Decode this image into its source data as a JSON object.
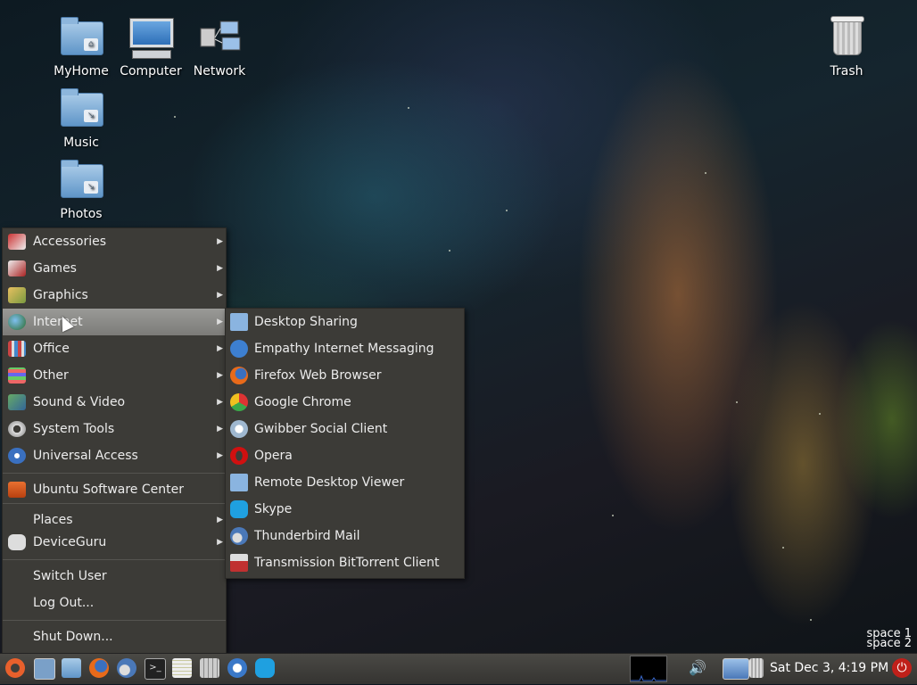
{
  "desktop": {
    "icons": [
      {
        "label": "MyHome",
        "icon": "home-folder-icon"
      },
      {
        "label": "Computer",
        "icon": "computer-icon"
      },
      {
        "label": "Network",
        "icon": "network-icon"
      },
      {
        "label": "Trash",
        "icon": "trash-icon"
      },
      {
        "label": "Music",
        "icon": "music-folder-icon"
      },
      {
        "label": "Photos",
        "icon": "photos-folder-icon"
      }
    ]
  },
  "main_menu": {
    "items": [
      {
        "label": "Accessories",
        "icon": "accessories-icon",
        "submenu": true
      },
      {
        "label": "Games",
        "icon": "games-icon",
        "submenu": true
      },
      {
        "label": "Graphics",
        "icon": "graphics-icon",
        "submenu": true
      },
      {
        "label": "Internet",
        "icon": "internet-icon",
        "submenu": true,
        "active": true
      },
      {
        "label": "Office",
        "icon": "office-icon",
        "submenu": true
      },
      {
        "label": "Other",
        "icon": "other-icon",
        "submenu": true
      },
      {
        "label": "Sound & Video",
        "icon": "sound-video-icon",
        "submenu": true
      },
      {
        "label": "System Tools",
        "icon": "system-tools-icon",
        "submenu": true
      },
      {
        "label": "Universal Access",
        "icon": "universal-access-icon",
        "submenu": true
      },
      {
        "label": "Ubuntu Software Center",
        "icon": "software-center-icon",
        "submenu": false
      },
      {
        "label": "Places",
        "icon": "",
        "submenu": true
      },
      {
        "label": "DeviceGuru",
        "icon": "deviceguru-icon",
        "submenu": true
      },
      {
        "label": "Switch User",
        "icon": "",
        "submenu": false
      },
      {
        "label": "Log Out...",
        "icon": "",
        "submenu": false
      },
      {
        "label": "Shut Down...",
        "icon": "",
        "submenu": false
      }
    ]
  },
  "internet_submenu": {
    "items": [
      {
        "label": "Desktop Sharing",
        "icon": "desktop-sharing-icon",
        "color": "#8ab4e0"
      },
      {
        "label": "Empathy Internet Messaging",
        "icon": "empathy-icon",
        "color": "#3d7fd0"
      },
      {
        "label": "Firefox Web Browser",
        "icon": "firefox-icon",
        "color": "#e86a1a"
      },
      {
        "label": "Google Chrome",
        "icon": "chrome-icon",
        "color": "#3aa84a"
      },
      {
        "label": "Gwibber Social Client",
        "icon": "gwibber-icon",
        "color": "#9fb8d0"
      },
      {
        "label": "Opera",
        "icon": "opera-icon",
        "color": "#d01010"
      },
      {
        "label": "Remote Desktop Viewer",
        "icon": "remote-desktop-icon",
        "color": "#8ab4e0"
      },
      {
        "label": "Skype",
        "icon": "skype-icon",
        "color": "#1fa0e0"
      },
      {
        "label": "Thunderbird Mail",
        "icon": "thunderbird-icon",
        "color": "#4a78b8"
      },
      {
        "label": "Transmission BitTorrent Client",
        "icon": "transmission-icon",
        "color": "#c03030"
      }
    ]
  },
  "workspaces": {
    "space1": "space 1",
    "space2": "space 2"
  },
  "taskbar": {
    "launchers": [
      "ubuntu-menu-icon",
      "show-desktop-icon",
      "home-folder-icon",
      "firefox-icon",
      "thunderbird-icon",
      "terminal-icon",
      "text-editor-icon",
      "calculator-icon",
      "finder-icon",
      "skype-icon"
    ],
    "tray": [
      "cpu-monitor-icon",
      "volume-icon",
      "network-icon",
      "trash-icon",
      "power-icon"
    ],
    "clock": "Sat Dec  3,  4:19 PM"
  },
  "colors": {
    "menu_bg": "#3c3b37",
    "menu_active": "#8a8986",
    "taskbar": "#3f3e3a"
  }
}
